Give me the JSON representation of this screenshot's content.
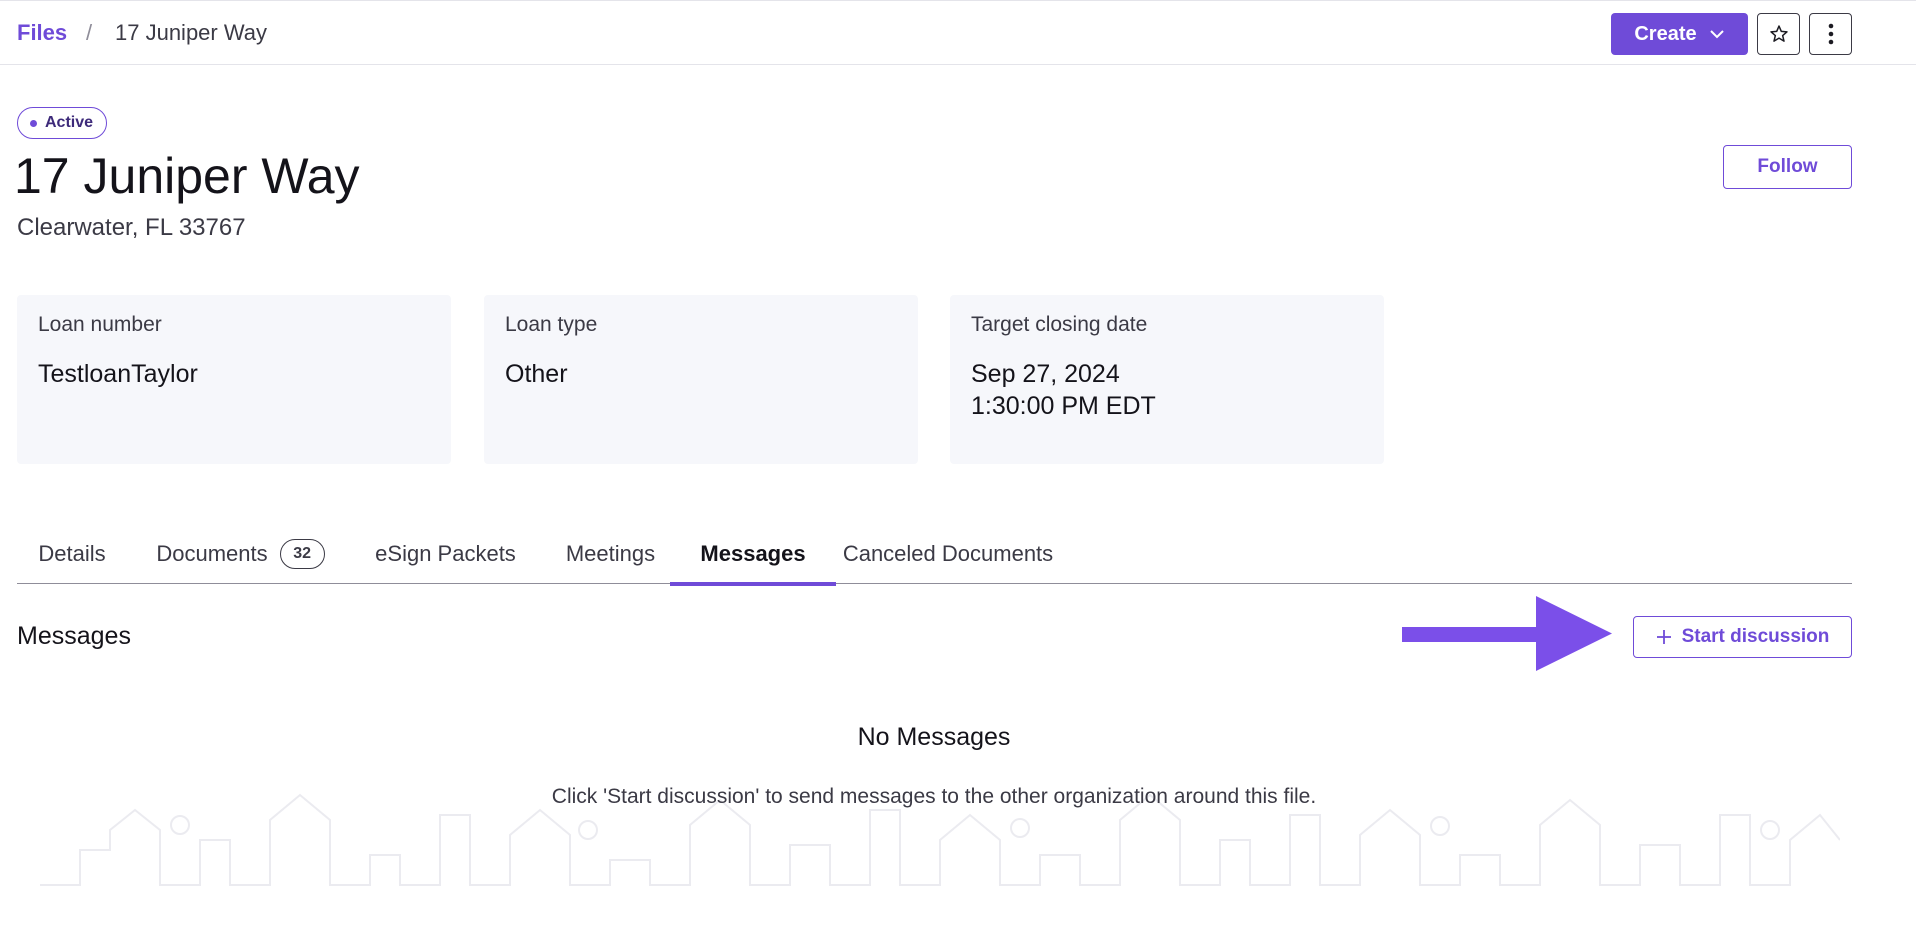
{
  "breadcrumb": {
    "root": "Files",
    "separator": "/",
    "current": "17 Juniper Way"
  },
  "header_actions": {
    "create_label": "Create",
    "create_icon": "chevron-down-icon",
    "star_icon": "star-icon",
    "more_icon": "vertical-ellipsis-icon"
  },
  "file": {
    "status": "Active",
    "title": "17 Juniper Way",
    "subtitle": "Clearwater, FL 33767",
    "follow_label": "Follow"
  },
  "cards": [
    {
      "label": "Loan number",
      "value": "TestloanTaylor"
    },
    {
      "label": "Loan type",
      "value": "Other"
    },
    {
      "label": "Target closing date",
      "value": "Sep 27, 2024",
      "value_line2": "1:30:00 PM EDT"
    }
  ],
  "tabs": [
    {
      "label": "Details"
    },
    {
      "label": "Documents",
      "count": "32"
    },
    {
      "label": "eSign Packets"
    },
    {
      "label": "Meetings"
    },
    {
      "label": "Messages",
      "active": true
    },
    {
      "label": "Canceled Documents"
    }
  ],
  "messages": {
    "section_title": "Messages",
    "start_label": "Start discussion",
    "start_icon": "plus-icon",
    "empty_title": "No Messages",
    "empty_text": "Click 'Start discussion' to send messages to the other organization around this file."
  },
  "colors": {
    "accent": "#6f4bd8",
    "arrow": "#7b4fe9",
    "card_bg": "#f6f7fb"
  }
}
